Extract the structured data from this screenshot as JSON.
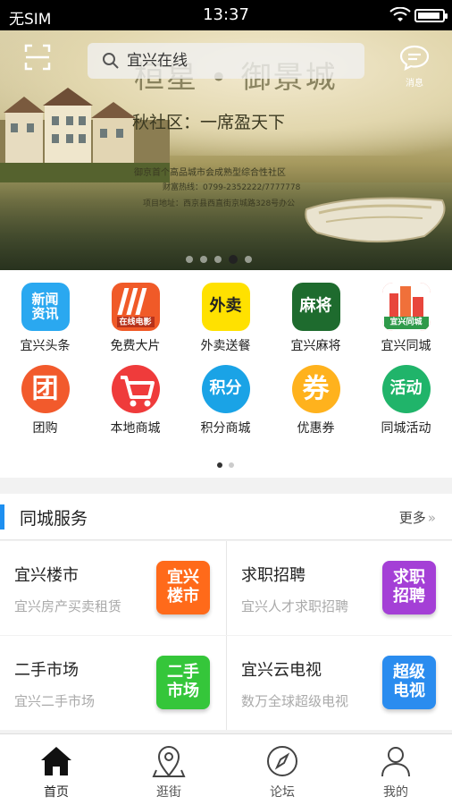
{
  "status_bar": {
    "carrier": "无SIM",
    "time": "13:37",
    "battery_level": 0.92
  },
  "banner": {
    "headline": "桓星 • 御景城",
    "tagline": "秋社区：一席盈天下",
    "subline1": "御京首个高品城市会成熟型综合性社区",
    "subline2": "财富热线：0799-2352222/7777778",
    "subline3": "项目地址：西京县西直街京城路328号办公",
    "search_placeholder": "宜兴在线",
    "message_label": "消息",
    "slide_count": 5,
    "active_slide": 4
  },
  "categories": [
    {
      "label": "宜兴头条",
      "icon": "news-icon",
      "icon_text": "新闻\n资讯",
      "color": "#2aa8f0"
    },
    {
      "label": "免费大片",
      "icon": "movie-icon",
      "icon_text": "在线电影",
      "color": "#f05a28"
    },
    {
      "label": "外卖送餐",
      "icon": "takeout-icon",
      "icon_text": "外卖",
      "color": "#ffe100"
    },
    {
      "label": "宜兴麻将",
      "icon": "mahjong-icon",
      "icon_text": "麻将",
      "color": "#1e6b2e"
    },
    {
      "label": "宜兴同城",
      "icon": "city-icon",
      "icon_text": "宜兴同城",
      "color": "#e8463c"
    },
    {
      "label": "团购",
      "icon": "group-buy-icon",
      "icon_text": "团",
      "color": "#f25a2c"
    },
    {
      "label": "本地商城",
      "icon": "cart-icon",
      "icon_text": "",
      "color": "#ef3b3b"
    },
    {
      "label": "积分商城",
      "icon": "points-icon",
      "icon_text": "积分",
      "color": "#1aa3e6"
    },
    {
      "label": "优惠券",
      "icon": "coupon-icon",
      "icon_text": "券",
      "color": "#ffb21d"
    },
    {
      "label": "同城活动",
      "icon": "activity-icon",
      "icon_text": "活动",
      "color": "#20b46a"
    }
  ],
  "category_pages": 2,
  "category_active_page": 1,
  "services": {
    "title": "同城服务",
    "more_label": "更多",
    "items": [
      {
        "title": "宜兴楼市",
        "desc": "宜兴房产买卖租赁",
        "badge": "宜兴\n楼市",
        "color": "#ff6a1a"
      },
      {
        "title": "求职招聘",
        "desc": "宜兴人才求职招聘",
        "badge": "求职\n招聘",
        "color": "#a43fd6"
      },
      {
        "title": "二手市场",
        "desc": "宜兴二手市场",
        "badge": "二手\n市场",
        "color": "#35c63a"
      },
      {
        "title": "宜兴云电视",
        "desc": "数万全球超级电视",
        "badge": "超级\n电视",
        "color": "#2a8cef"
      }
    ]
  },
  "tabbar": [
    {
      "label": "首页",
      "icon": "home-icon",
      "active": true
    },
    {
      "label": "逛街",
      "icon": "map-pin-icon",
      "active": false
    },
    {
      "label": "论坛",
      "icon": "compass-icon",
      "active": false
    },
    {
      "label": "我的",
      "icon": "user-icon",
      "active": false
    }
  ]
}
